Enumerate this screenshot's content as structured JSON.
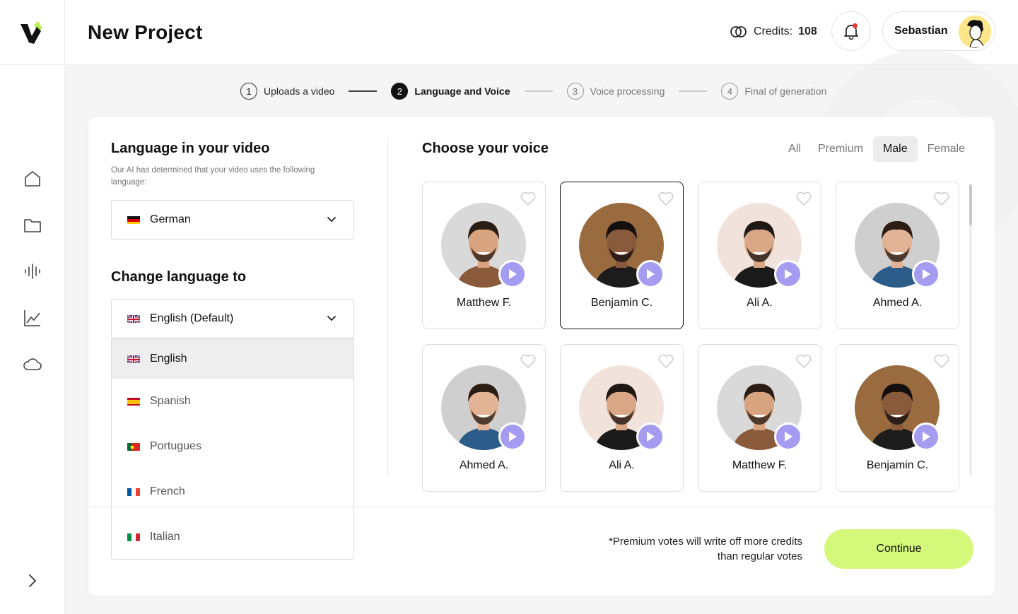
{
  "header": {
    "title": "New Project",
    "credits_label": "Credits:",
    "credits_value": "108",
    "user_name": "Sebastian"
  },
  "sidebar": {
    "items": [
      {
        "icon": "home-icon"
      },
      {
        "icon": "folder-icon"
      },
      {
        "icon": "audio-waveform-icon"
      },
      {
        "icon": "analytics-chart-icon"
      },
      {
        "icon": "cloud-icon"
      }
    ]
  },
  "stepper": {
    "steps": [
      {
        "num": "1",
        "label": "Uploads a video",
        "state": "done"
      },
      {
        "num": "2",
        "label": "Language and Voice",
        "state": "active"
      },
      {
        "num": "3",
        "label": "Voice processing",
        "state": "pending"
      },
      {
        "num": "4",
        "label": "Final of generation",
        "state": "pending"
      }
    ]
  },
  "language": {
    "title": "Language in your video",
    "subtitle": "Our AI has determined that your video uses the following language:",
    "detected": "German",
    "change_title": "Change language to",
    "selected": "English (Default)",
    "options": [
      "English",
      "Spanish",
      "Portugues",
      "French",
      "Italian"
    ]
  },
  "voice": {
    "title": "Choose your voice",
    "filters": [
      "All",
      "Premium",
      "Male",
      "Female"
    ],
    "active_filter": "Male",
    "cards": [
      {
        "name": "Matthew F.",
        "selected": false
      },
      {
        "name": "Benjamin C.",
        "selected": true
      },
      {
        "name": "Ali A.",
        "selected": false
      },
      {
        "name": "Ahmed A.",
        "selected": false
      },
      {
        "name": "Ahmed A.",
        "selected": false
      },
      {
        "name": "Ali A.",
        "selected": false
      },
      {
        "name": "Matthew F.",
        "selected": false
      },
      {
        "name": "Benjamin C.",
        "selected": false
      }
    ]
  },
  "footer": {
    "note_line1": "*Premium votes will write off more credits",
    "note_line2": "than regular votes",
    "continue_label": "Continue"
  },
  "colors": {
    "accent": "#d4f87a",
    "play": "#a59bf0",
    "notification": "#e53935"
  }
}
